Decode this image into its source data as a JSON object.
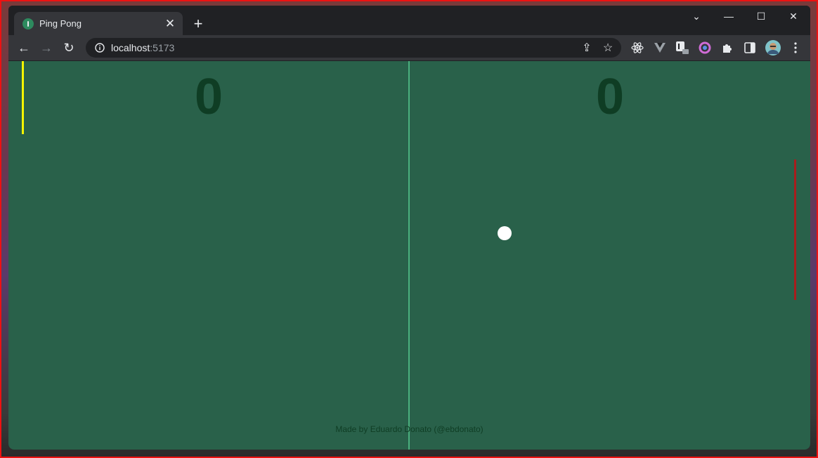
{
  "browser": {
    "tab": {
      "title": "Ping Pong",
      "close_glyph": "✕"
    },
    "new_tab_glyph": "+",
    "window_controls": {
      "tab_search": "⌄",
      "minimize": "—",
      "maximize": "☐",
      "close": "✕"
    },
    "toolbar": {
      "back_glyph": "←",
      "forward_glyph": "→",
      "reload_glyph": "↻",
      "url_host": "localhost",
      "url_port": ":5173",
      "share_glyph": "⇪",
      "bookmark_glyph": "☆"
    },
    "extensions": [
      "react-devtools-icon",
      "vue-devtools-icon",
      "extension-icon",
      "color-picker-icon",
      "puzzle-icon",
      "side-panel-icon",
      "avatar"
    ]
  },
  "game": {
    "left_score": "0",
    "right_score": "0",
    "credit": "Made by Eduardo Donato (@ebdonato)"
  },
  "colors": {
    "field": "#29614a",
    "net": "#4bb07e",
    "score": "#0f3d24",
    "left_paddle": "#f5f500",
    "right_paddle": "#a81d1d",
    "ball": "#ffffff"
  }
}
